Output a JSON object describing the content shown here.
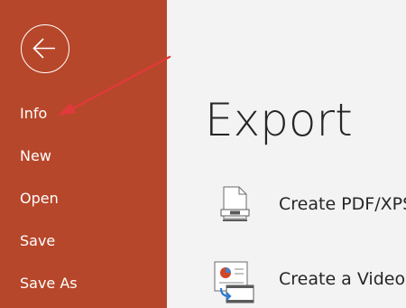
{
  "sidebar": {
    "back_icon": "back-arrow-icon",
    "items": [
      {
        "label": "Info"
      },
      {
        "label": "New"
      },
      {
        "label": "Open"
      },
      {
        "label": "Save"
      },
      {
        "label": "Save As"
      }
    ]
  },
  "main": {
    "title": "Export",
    "options": [
      {
        "label": "Create PDF/XPS Document",
        "icon": "pdf-document-icon"
      },
      {
        "label": "Create a Video",
        "icon": "video-icon"
      }
    ]
  },
  "annotation": {
    "icon": "red-arrow-pointer-icon",
    "color": "#e03a3a"
  },
  "colors": {
    "sidebar": "#b7472a",
    "background": "#f3f3f3",
    "text": "#262626"
  }
}
